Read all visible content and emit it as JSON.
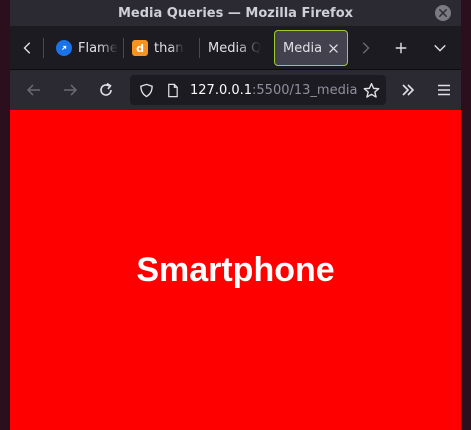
{
  "window": {
    "title": "Media Queries — Mozilla Firefox"
  },
  "tabs": [
    {
      "label": "Flame",
      "favicon": "flame-favicon-icon",
      "favicon_color": "#1a73e8",
      "active": false
    },
    {
      "label": "than",
      "favicon": "d-favicon-icon",
      "favicon_letter": "d",
      "favicon_color": "#f6921e",
      "active": false
    },
    {
      "label": "Media Q",
      "favicon": null,
      "active": false
    },
    {
      "label": "Media",
      "favicon": null,
      "active": true
    }
  ],
  "navbar": {
    "url_host": "127.0.0.1",
    "url_rest": ":5500/13_media"
  },
  "page": {
    "heading": "Smartphone",
    "background": "#ff0000",
    "text_color": "#ffffff"
  },
  "colors": {
    "active_tab_border": "#9acd32",
    "chrome_dark": "#1c1b22",
    "chrome": "#2b2a33"
  }
}
